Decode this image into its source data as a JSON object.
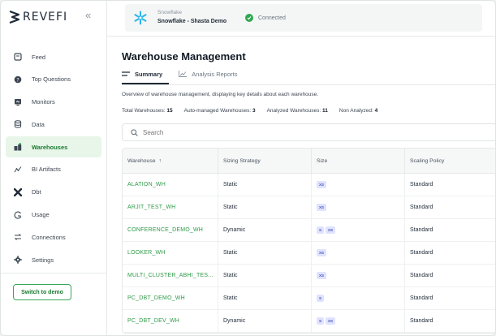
{
  "brand": {
    "name": "REVEFI",
    "collapse_glyph": "«"
  },
  "sidebar": {
    "items": [
      {
        "label": "Feed",
        "icon": "feed-icon"
      },
      {
        "label": "Top Questions",
        "icon": "question-icon"
      },
      {
        "label": "Monitors",
        "icon": "monitor-icon"
      },
      {
        "label": "Data",
        "icon": "database-icon"
      },
      {
        "label": "Warehouses",
        "icon": "warehouse-icon",
        "active": true
      },
      {
        "label": "BI Artifacts",
        "icon": "bi-artifacts-icon"
      },
      {
        "label": "Dbt",
        "icon": "dbt-icon"
      },
      {
        "label": "Usage",
        "icon": "usage-icon"
      },
      {
        "label": "Connections",
        "icon": "connections-icon"
      },
      {
        "label": "Settings",
        "icon": "gear-icon"
      }
    ],
    "demo_button": "Switch to demo"
  },
  "connection": {
    "provider": "Snowflake",
    "name": "Snowflake - Shasta Demo",
    "status": "Connected",
    "status_color": "#2fa84f"
  },
  "main": {
    "title": "Warehouse Management",
    "tabs": [
      {
        "label": "Summary",
        "active": true
      },
      {
        "label": "Analysis Reports",
        "active": false
      }
    ],
    "overview": "Overview of warehouse management, displaying key details about each warehouse.",
    "stats": {
      "total_label": "Total Warehouses:",
      "total_value": "15",
      "auto_label": "Auto-managed Warehouses:",
      "auto_value": "3",
      "analyzed_label": "Analyzed Warehouses:",
      "analyzed_value": "11",
      "non_label": "Non Analyzed:",
      "non_value": "4"
    },
    "search_placeholder": "Search",
    "table": {
      "headers": [
        "Warehouse",
        "Sizing Strategy",
        "Size",
        "Scaling Policy"
      ],
      "sort_glyph": "↑",
      "rows": [
        {
          "warehouse": "ALATION_WH",
          "strategy": "Static",
          "sizes": [
            "XS"
          ],
          "policy": "Standard"
        },
        {
          "warehouse": "ARJIT_TEST_WH",
          "strategy": "Static",
          "sizes": [
            "XS"
          ],
          "policy": "Standard"
        },
        {
          "warehouse": "CONFERENCE_DEMO_WH",
          "strategy": "Dynamic",
          "sizes": [
            "S",
            "XS"
          ],
          "policy": "Standard"
        },
        {
          "warehouse": "LOOKER_WH",
          "strategy": "Static",
          "sizes": [
            "XS"
          ],
          "policy": "Standard"
        },
        {
          "warehouse": "MULTI_CLUSTER_ABHI_TES...",
          "strategy": "Static",
          "sizes": [
            "XS"
          ],
          "policy": "Standard"
        },
        {
          "warehouse": "PC_DBT_DEMO_WH",
          "strategy": "Static",
          "sizes": [
            "S"
          ],
          "policy": "Standard"
        },
        {
          "warehouse": "PC_DBT_DEV_WH",
          "strategy": "Dynamic",
          "sizes": [
            "S",
            "XS"
          ],
          "policy": "Standard"
        }
      ]
    },
    "accent_color": "#2f9a48"
  }
}
